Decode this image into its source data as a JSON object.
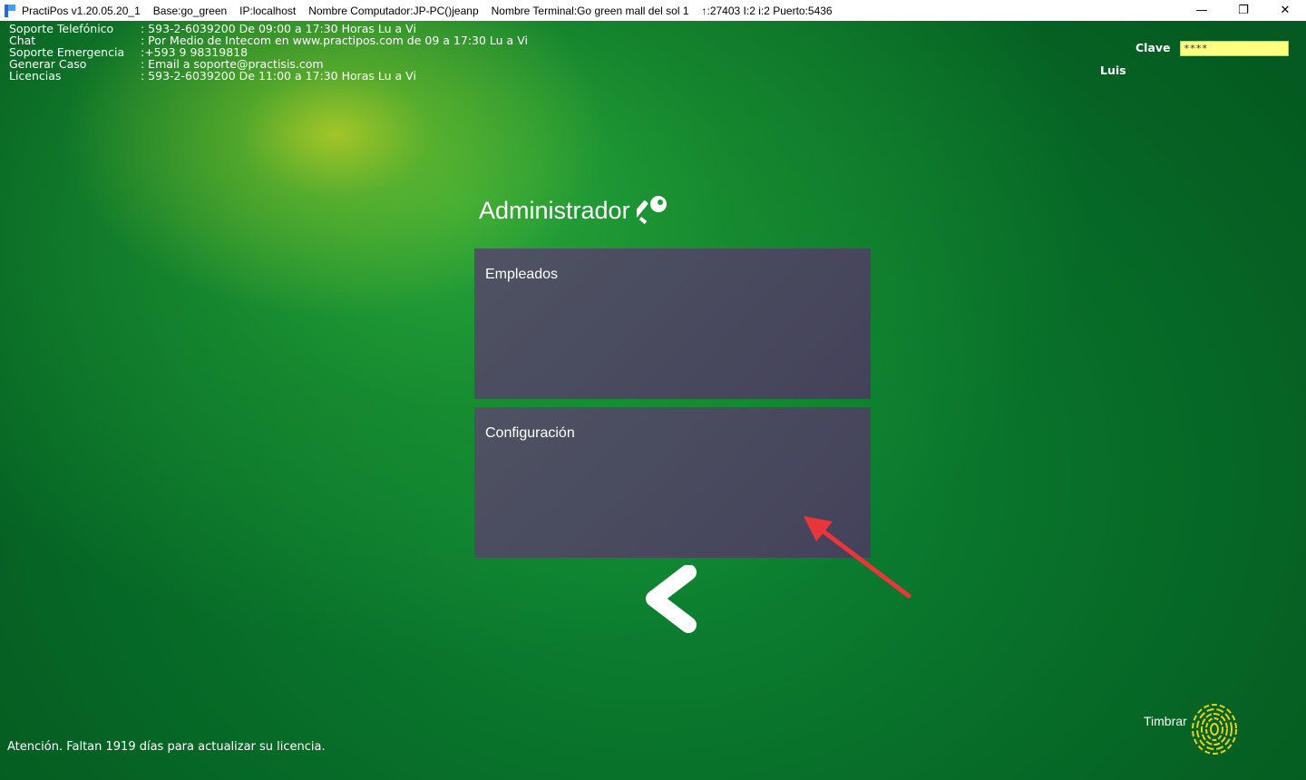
{
  "window": {
    "app_version": "PractiPos v1.20.05.20_1",
    "base": "Base:go_green",
    "ip": "IP:localhost",
    "computer": "Nombre Computador:JP-PC()jeanp",
    "terminal": "Nombre Terminal:Go green mall del sol 1",
    "connection": "↑:27403 I:2 i:2 Puerto:5436",
    "minimize": "—",
    "restore": "❐",
    "close": "✕"
  },
  "support": [
    {
      "key": "Soporte Telefónico",
      "value": ": 593-2-6039200  De 09:00 a 17:30 Horas Lu a Vi"
    },
    {
      "key": " Chat",
      "value": "  : Por Medio de Intecom en www.practipos.com de 09 a 17:30 Lu a Vi"
    },
    {
      "key": " Soporte Emergencia",
      "value": ":+593 9 98319818"
    },
    {
      "key": " Generar Caso",
      "value": ": Email a soporte@practisis.com"
    },
    {
      "key": " Licencias",
      "value": "  : 593-2-6039200  De 11:00 a 17:30 Horas Lu a Vi"
    }
  ],
  "login": {
    "clave_label": "Clave",
    "clave_value": "****",
    "user": "Luis"
  },
  "main": {
    "title": "Administrador",
    "tiles": [
      {
        "label": "Empleados"
      },
      {
        "label": "Configuración"
      }
    ]
  },
  "status_message": "Atención. Faltan 1919 días para actualizar su licencia.",
  "timbrar_label": "Timbrar",
  "colors": {
    "tile_bg": "#4f4f66",
    "annotation_arrow": "#e8363a",
    "clave_input_bg": "#ffff80",
    "fingerprint": "#e8d21a"
  },
  "icons": {
    "key": "key-icon",
    "back": "chevron-left-icon",
    "fingerprint": "fingerprint-icon"
  }
}
